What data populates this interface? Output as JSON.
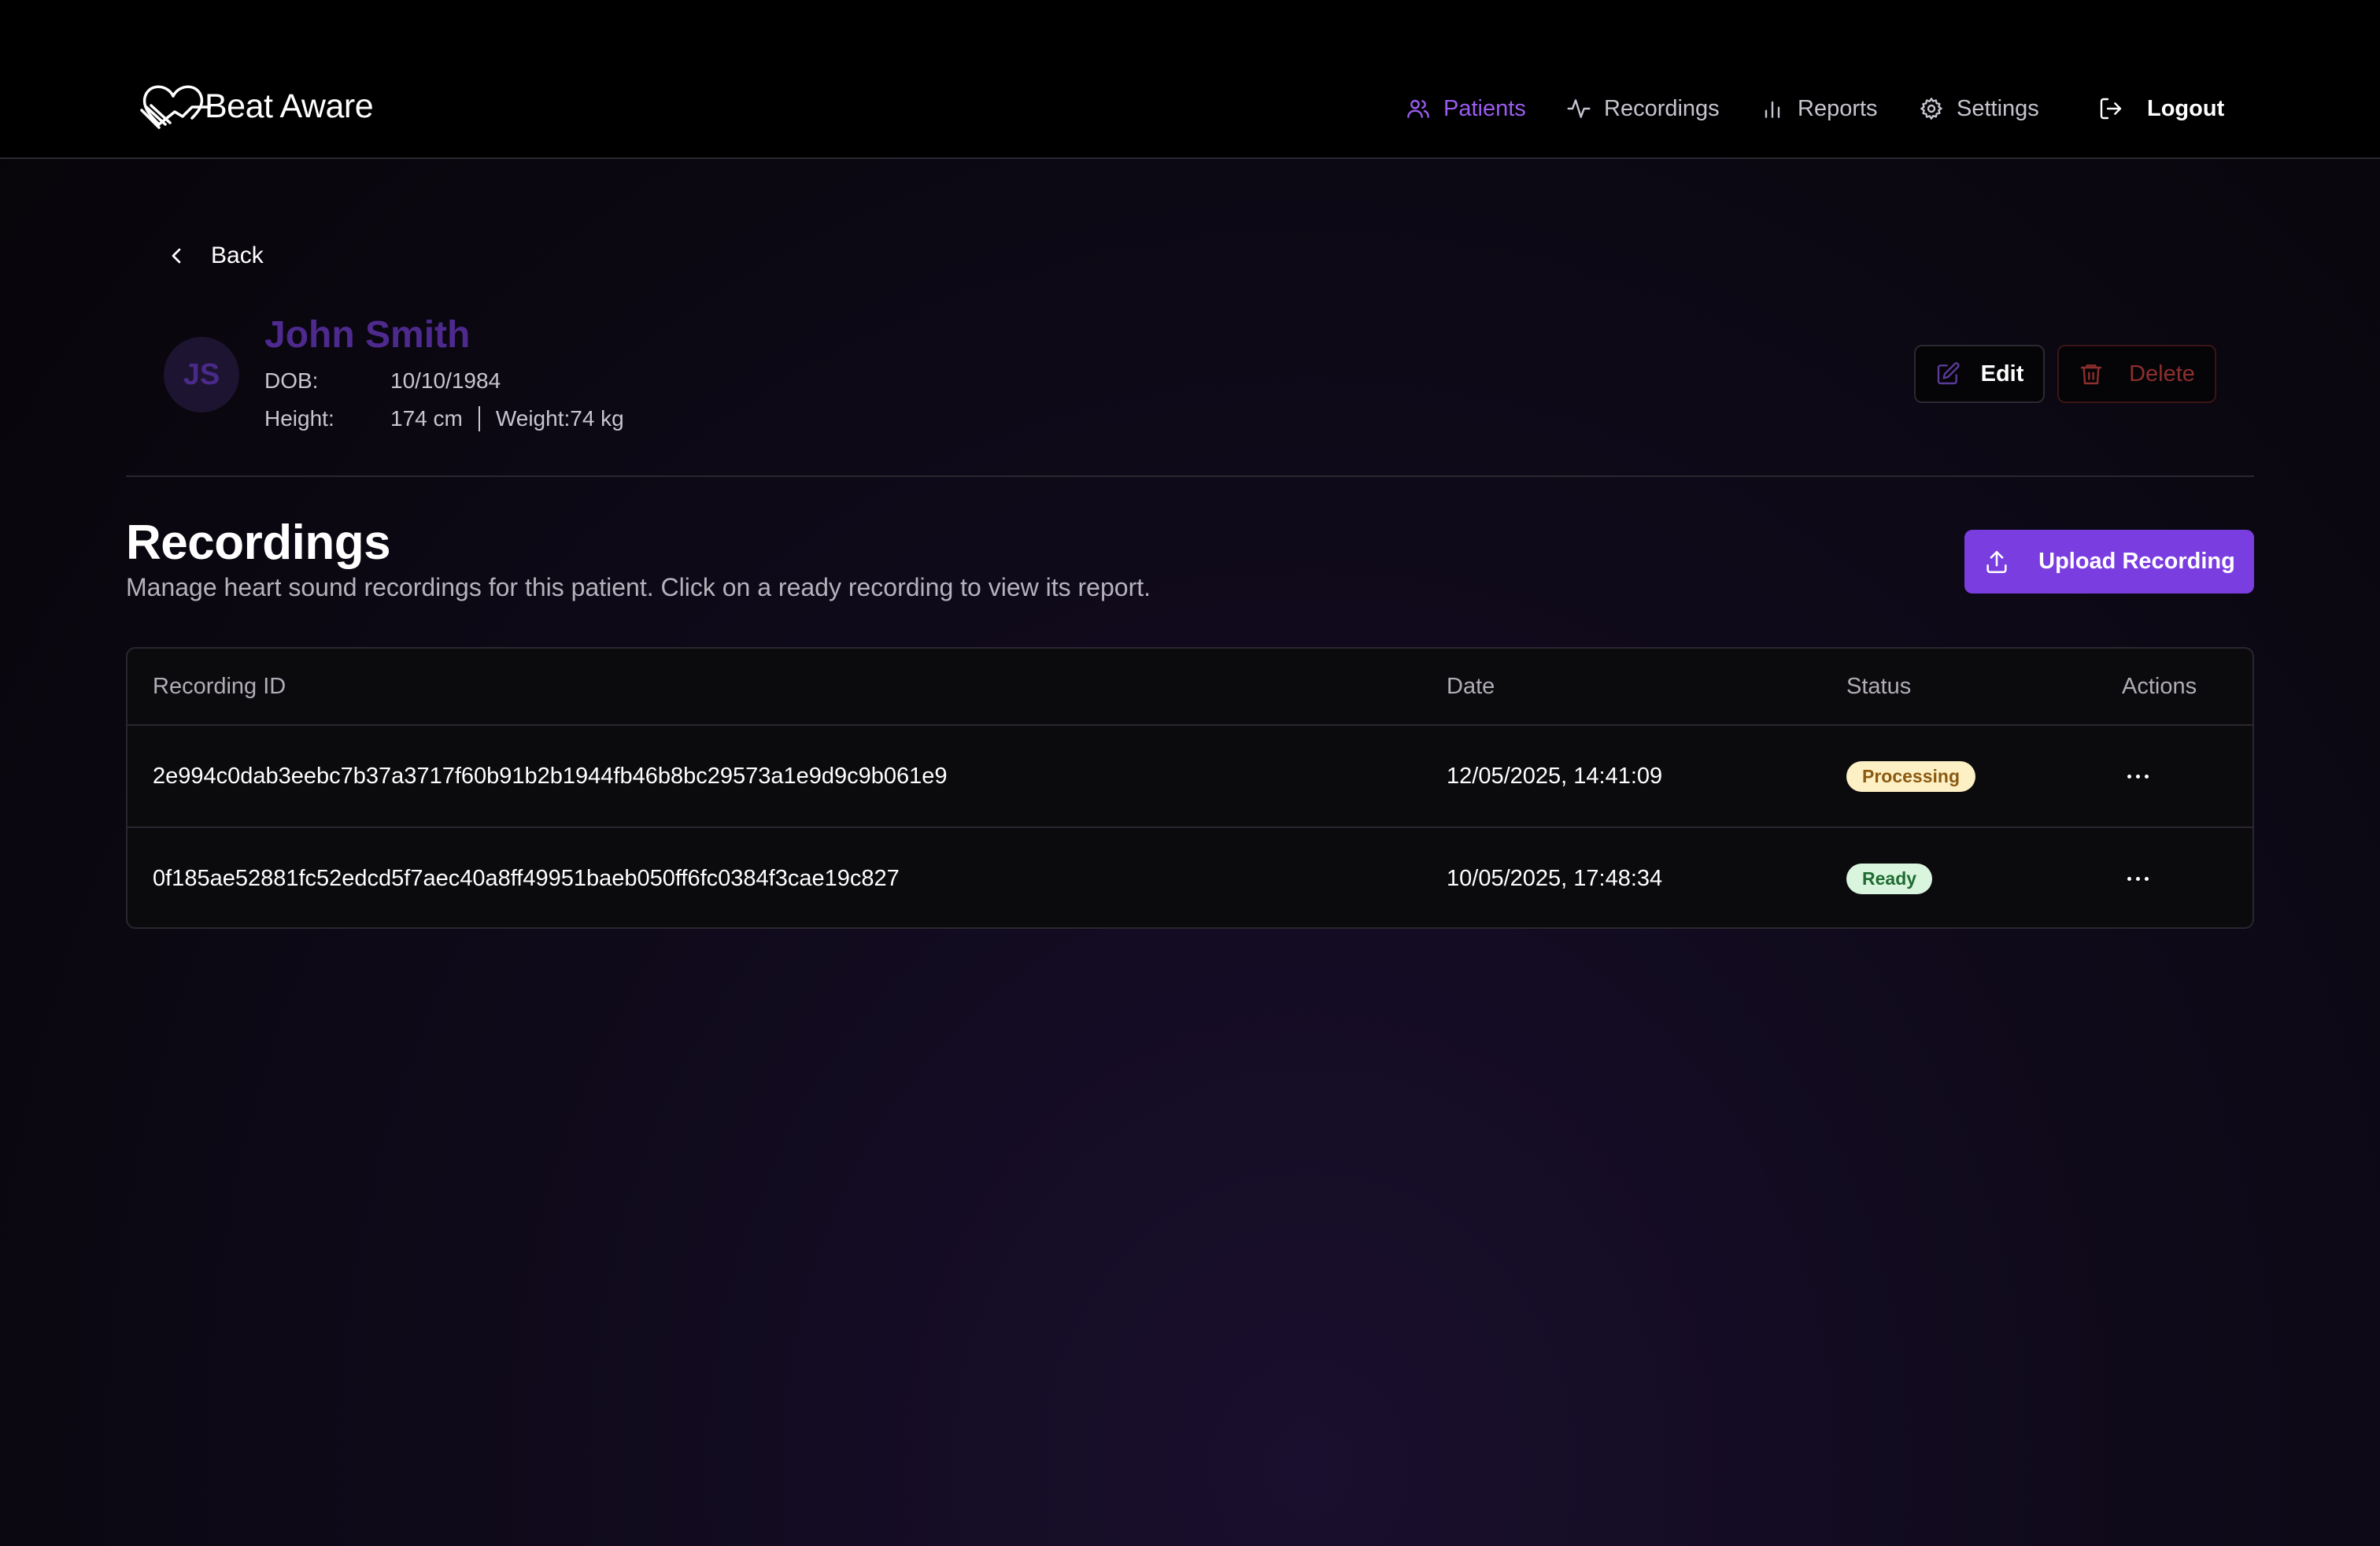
{
  "header": {
    "brand": "Beat Aware",
    "nav": [
      {
        "label": "Patients",
        "icon": "users-icon",
        "active": true
      },
      {
        "label": "Recordings",
        "icon": "activity-icon",
        "active": false
      },
      {
        "label": "Reports",
        "icon": "bar-chart-icon",
        "active": false
      },
      {
        "label": "Settings",
        "icon": "gear-icon",
        "active": false
      }
    ],
    "logout_label": "Logout"
  },
  "back_label": "Back",
  "patient": {
    "initials": "JS",
    "name": "John Smith",
    "dob_label": "DOB:",
    "dob": "10/10/1984",
    "height_label": "Height:",
    "height": "174 cm",
    "weight": "Weight:74 kg",
    "edit_label": "Edit",
    "delete_label": "Delete"
  },
  "recordings": {
    "title": "Recordings",
    "description": "Manage heart sound recordings for this patient. Click on a ready recording to view its report.",
    "upload_label": "Upload Recording",
    "columns": {
      "id": "Recording ID",
      "date": "Date",
      "status": "Status",
      "actions": "Actions"
    },
    "rows": [
      {
        "id": "2e994c0dab3eebc7b37a3717f60b91b2b1944fb46b8bc29573a1e9d9c9b061e9",
        "date": "12/05/2025, 14:41:09",
        "status": "Processing",
        "status_bg": "#fdf0c4",
        "status_fg": "#8a5a12"
      },
      {
        "id": "0f185ae52881fc52edcd5f7aec40a8ff49951baeb050ff6fc0384f3cae19c827",
        "date": "10/05/2025, 17:48:34",
        "status": "Ready",
        "status_bg": "#d9f5dd",
        "status_fg": "#1f6b33"
      }
    ]
  },
  "colors": {
    "accent": "#7a3de0",
    "active_nav": "#9b5cf0",
    "danger": "#8c2f2f"
  }
}
